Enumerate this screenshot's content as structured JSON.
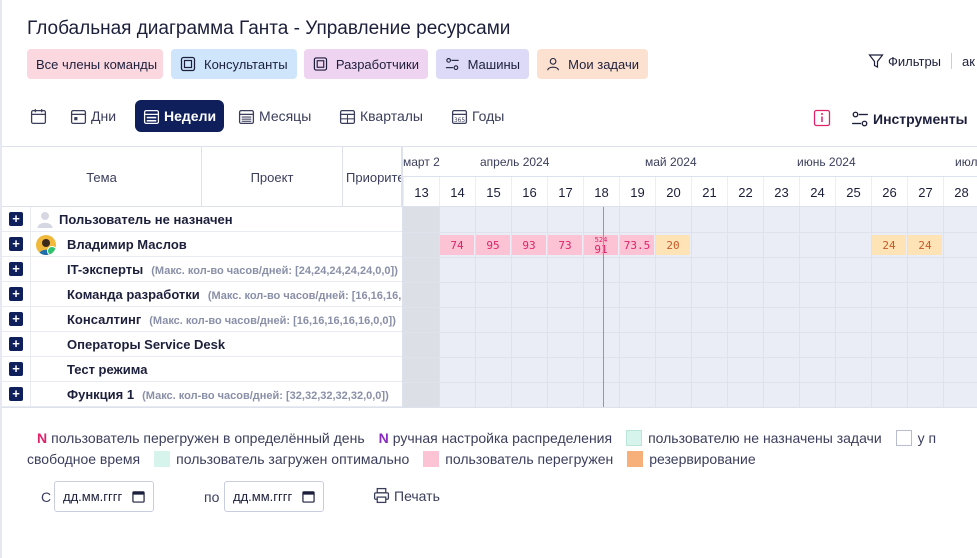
{
  "title": "Глобальная диаграмма Ганта - Управление ресурсами",
  "chips": {
    "all": "Все члены команды",
    "consultants": "Консультанты",
    "developers": "Разработчики",
    "machines": "Машины",
    "my_tasks": "Мои задачи"
  },
  "filters": {
    "label": "Фильтры",
    "trail": "ак"
  },
  "scales": {
    "days": "Дни",
    "weeks": "Недели",
    "months": "Месяцы",
    "quarters": "Кварталы",
    "years": "Годы",
    "selected": "weeks"
  },
  "tools_label": "Инструменты",
  "columns": {
    "tema": "Тема",
    "project": "Проект",
    "priority": "Приорите"
  },
  "months": [
    "март 2",
    "апрель 2024",
    "май 2024",
    "июнь 2024",
    "июл"
  ],
  "weeks": [
    "13",
    "14",
    "15",
    "16",
    "17",
    "18",
    "19",
    "20",
    "21",
    "22",
    "23",
    "24",
    "25",
    "26",
    "27",
    "28"
  ],
  "rows": [
    {
      "label": "Пользователь не назначен",
      "sub": ""
    },
    {
      "label": "Владимир Маслов",
      "sub": ""
    },
    {
      "label": "IT-эксперты",
      "sub": "(Макс. кол-во часов/дней: [24,24,24,24,24,0,0])"
    },
    {
      "label": "Команда разработки",
      "sub": "(Макс. кол-во часов/дней: [16,16,16,16,16,0,0])"
    },
    {
      "label": "Консалтинг",
      "sub": "(Макс. кол-во часов/дней: [16,16,16,16,16,0,0])"
    },
    {
      "label": "Операторы Service Desk",
      "sub": ""
    },
    {
      "label": "Тест режима",
      "sub": ""
    },
    {
      "label": "Функция 1",
      "sub": "(Макс. кол-во часов/дней: [32,32,32,32,32,0,0])"
    }
  ],
  "bars": {
    "w14": "74",
    "w15": "95",
    "w16": "93",
    "w17": "73",
    "w18_top": "524",
    "w18": "91",
    "w19": "73.5",
    "w20": "20",
    "w26": "24",
    "w27": "24"
  },
  "legend": {
    "n": "N",
    "overloaded_day": "пользователь перегружен в определённый день",
    "manual": "ручная настройка распределения",
    "no_tasks": "пользователю не назначены задачи",
    "cut": "у п",
    "free_time": "свободное время",
    "optimal": "пользователь загружен оптимально",
    "overloaded": "пользователь перегружен",
    "reserved": "резервирование"
  },
  "colors": {
    "n_red": "#e0226a",
    "n_purple": "#8a2bbf",
    "no_tasks": "#d7f4ec",
    "optimal": "#d7f4ec",
    "overloaded": "#fbc3d4",
    "reserved": "#f8b07a",
    "accent": "#0e1f5b"
  },
  "dates": {
    "from_label": "С",
    "to_label": "по",
    "from_placeholder": "дд.мм.гггг",
    "to_placeholder": "дд.мм.гггг"
  },
  "print_label": "Печать"
}
